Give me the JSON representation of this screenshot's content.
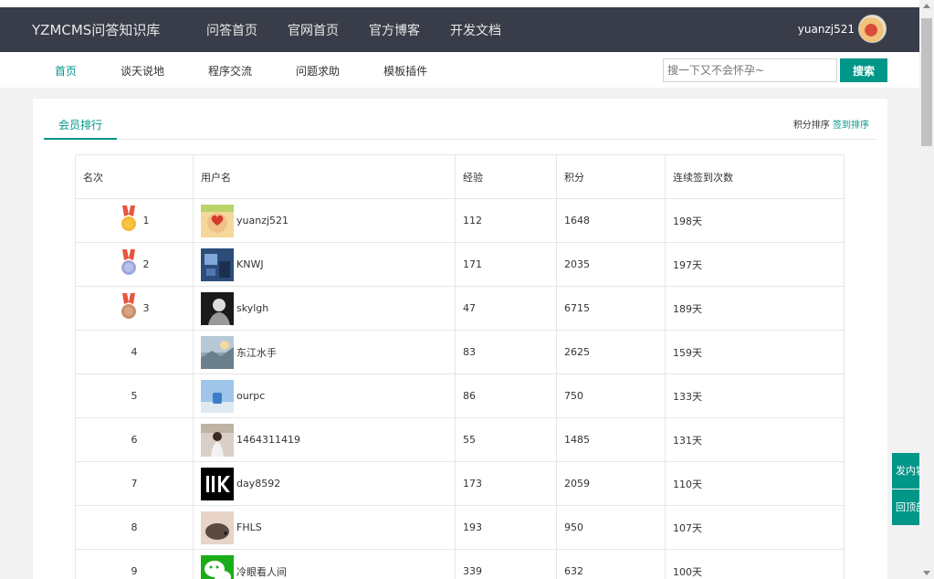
{
  "header": {
    "brand": "YZMCMS问答知识库",
    "nav": [
      "问答首页",
      "官网首页",
      "官方博客",
      "开发文档"
    ],
    "username": "yuanzj521"
  },
  "subnav": {
    "items": [
      "首页",
      "谈天说地",
      "程序交流",
      "问题求助",
      "模板插件"
    ],
    "active_index": 0,
    "search_placeholder": "搜一下又不会怀孕~",
    "search_button": "搜索"
  },
  "panel": {
    "tab": "会员排行",
    "sort_label": "积分排序",
    "sort_link": "签到排序"
  },
  "table": {
    "headers": [
      "名次",
      "用户名",
      "经验",
      "积分",
      "连续签到次数"
    ],
    "rows": [
      {
        "rank": "1",
        "medal": "gold",
        "avatar": "heart-hand",
        "name": "yuanzj521",
        "exp": "112",
        "points": "1648",
        "streak": "198天"
      },
      {
        "rank": "2",
        "medal": "silver",
        "avatar": "blue-room",
        "name": "KNWJ",
        "exp": "171",
        "points": "2035",
        "streak": "197天"
      },
      {
        "rank": "3",
        "medal": "bronze",
        "avatar": "bw-portrait",
        "name": "skylgh",
        "exp": "47",
        "points": "6715",
        "streak": "189天"
      },
      {
        "rank": "4",
        "medal": "",
        "avatar": "seaside",
        "name": "东江水手",
        "exp": "83",
        "points": "2625",
        "streak": "159天"
      },
      {
        "rank": "5",
        "medal": "",
        "avatar": "sky-cup",
        "name": "ourpc",
        "exp": "86",
        "points": "750",
        "streak": "133天"
      },
      {
        "rank": "6",
        "medal": "",
        "avatar": "girl-street",
        "name": "1464311419",
        "exp": "55",
        "points": "1485",
        "streak": "131天"
      },
      {
        "rank": "7",
        "medal": "",
        "avatar": "mk-logo",
        "name": "day8592",
        "exp": "173",
        "points": "2059",
        "streak": "110天"
      },
      {
        "rank": "8",
        "medal": "",
        "avatar": "hedgehog",
        "name": "FHLS",
        "exp": "193",
        "points": "950",
        "streak": "107天"
      },
      {
        "rank": "9",
        "medal": "",
        "avatar": "wechat",
        "name": "冷眼看人间",
        "exp": "339",
        "points": "632",
        "streak": "100天"
      }
    ]
  },
  "float_buttons": [
    "发内容",
    "回顶部"
  ],
  "colors": {
    "accent": "#009688",
    "topbar": "#393d49"
  }
}
